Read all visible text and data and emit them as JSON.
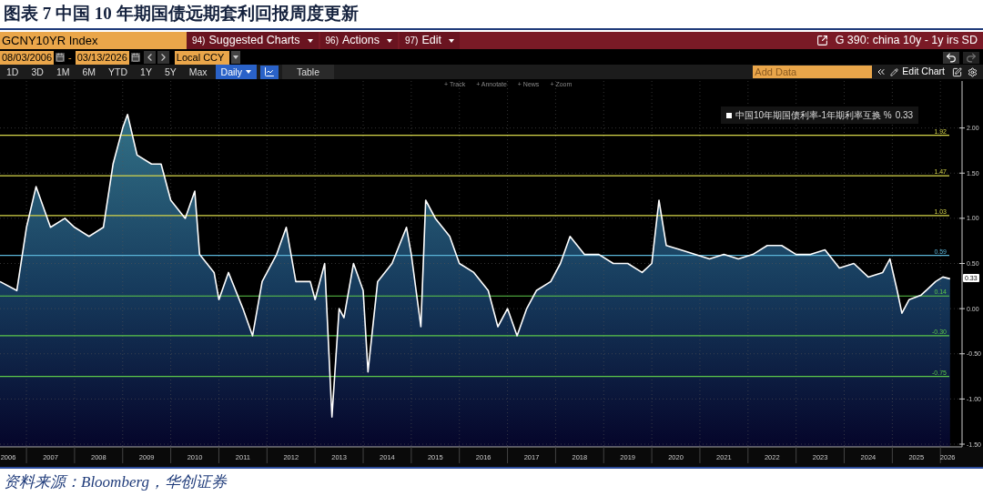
{
  "figure_title": "图表 7 中国 10 年期国债远期套利回报周度更新",
  "terminal": {
    "security_field": "GCNY10YR Index",
    "menu": [
      {
        "number": "94)",
        "label": "Suggested Charts"
      },
      {
        "number": "96)",
        "label": "Actions"
      },
      {
        "number": "97)",
        "label": "Edit"
      }
    ],
    "function_title": "G 390: china 10y - 1y irs SD",
    "date_start": "08/03/2006",
    "date_separator": "-",
    "date_end": "03/13/2026",
    "currency": "Local CCY",
    "ranges": [
      {
        "label": "1D",
        "selected": false
      },
      {
        "label": "3D",
        "selected": false
      },
      {
        "label": "1M",
        "selected": false
      },
      {
        "label": "6M",
        "selected": false
      },
      {
        "label": "YTD",
        "selected": false
      },
      {
        "label": "1Y",
        "selected": false
      },
      {
        "label": "5Y",
        "selected": false
      },
      {
        "label": "Max",
        "selected": false
      }
    ],
    "frequency": "Daily",
    "views": [
      {
        "kind": "icon",
        "selected": true
      },
      {
        "kind": "text",
        "label": "Table",
        "selected": false
      }
    ],
    "add_data_placeholder": "Add Data",
    "edit_chart": "Edit Chart",
    "chart_tools": [
      "+ Track",
      "+ Annotate",
      "+ News",
      "+ Zoom"
    ],
    "legend_value": "0.33",
    "last_value_tag": "0.33",
    "chart_data": {
      "type": "area",
      "x": [
        2006.45,
        2006.8,
        2007.0,
        2007.2,
        2007.5,
        2007.8,
        2008.0,
        2008.3,
        2008.6,
        2008.8,
        2009.0,
        2009.1,
        2009.3,
        2009.6,
        2009.8,
        2010.0,
        2010.3,
        2010.5,
        2010.6,
        2010.9,
        2011.0,
        2011.2,
        2011.5,
        2011.7,
        2011.9,
        2012.2,
        2012.4,
        2012.6,
        2012.9,
        2013.0,
        2013.2,
        2013.35,
        2013.5,
        2013.6,
        2013.8,
        2014.0,
        2014.1,
        2014.3,
        2014.6,
        2014.9,
        2015.0,
        2015.2,
        2015.3,
        2015.5,
        2015.8,
        2016.0,
        2016.3,
        2016.6,
        2016.8,
        2017.0,
        2017.2,
        2017.4,
        2017.6,
        2017.9,
        2018.1,
        2018.3,
        2018.6,
        2018.9,
        2019.2,
        2019.5,
        2019.8,
        2020.0,
        2020.15,
        2020.3,
        2020.6,
        2020.9,
        2021.2,
        2021.5,
        2021.8,
        2022.1,
        2022.4,
        2022.7,
        2023.0,
        2023.3,
        2023.6,
        2023.9,
        2024.2,
        2024.5,
        2024.8,
        2024.95,
        2025.1,
        2025.2,
        2025.35,
        2025.6,
        2025.9,
        2026.05,
        2026.2
      ],
      "series": [
        {
          "name": "中国10年期国债利率-1年期利率互换 %",
          "color": "#ffffff",
          "values": [
            0.3,
            0.2,
            0.9,
            1.35,
            0.9,
            1.0,
            0.9,
            0.8,
            0.9,
            1.6,
            2.0,
            2.15,
            1.7,
            1.6,
            1.6,
            1.2,
            1.0,
            1.3,
            0.6,
            0.4,
            0.1,
            0.4,
            0.0,
            -0.3,
            0.3,
            0.6,
            0.9,
            0.3,
            0.3,
            0.1,
            0.5,
            -1.2,
            0.0,
            -0.1,
            0.5,
            0.2,
            -0.7,
            0.3,
            0.5,
            0.9,
            0.6,
            -0.2,
            1.2,
            1.0,
            0.8,
            0.5,
            0.4,
            0.2,
            -0.2,
            0.0,
            -0.3,
            0.0,
            0.2,
            0.3,
            0.5,
            0.8,
            0.6,
            0.6,
            0.5,
            0.5,
            0.4,
            0.5,
            1.2,
            0.7,
            0.65,
            0.6,
            0.55,
            0.6,
            0.55,
            0.6,
            0.7,
            0.7,
            0.6,
            0.6,
            0.65,
            0.45,
            0.5,
            0.35,
            0.4,
            0.55,
            0.2,
            -0.05,
            0.1,
            0.15,
            0.3,
            0.35,
            0.33
          ]
        }
      ],
      "ylim": [
        -1.53,
        2.52
      ],
      "yticks": [
        {
          "value": 2,
          "label": "2.00"
        },
        {
          "value": 1.5,
          "label": "1.50"
        },
        {
          "value": 1,
          "label": "1.00"
        },
        {
          "value": 0.5,
          "label": "0.50"
        },
        {
          "value": 0,
          "label": "0.00"
        },
        {
          "value": -0.5,
          "label": "-0.50"
        },
        {
          "value": -1,
          "label": "-1.00"
        },
        {
          "value": -1.5,
          "label": "-1.50"
        }
      ],
      "xlim": [
        2006.45,
        2026.45
      ],
      "grid": true,
      "xticks": [
        {
          "value": 2006.5,
          "label": "2006"
        },
        {
          "value": 2007.5,
          "label": "2007"
        },
        {
          "value": 2008.5,
          "label": "2008"
        },
        {
          "value": 2009.5,
          "label": "2009"
        },
        {
          "value": 2010.5,
          "label": "2010"
        },
        {
          "value": 2011.5,
          "label": "2011"
        },
        {
          "value": 2012.5,
          "label": "2012"
        },
        {
          "value": 2013.5,
          "label": "2013"
        },
        {
          "value": 2014.5,
          "label": "2014"
        },
        {
          "value": 2015.5,
          "label": "2015"
        },
        {
          "value": 2016.5,
          "label": "2016"
        },
        {
          "value": 2017.5,
          "label": "2017"
        },
        {
          "value": 2018.5,
          "label": "2018"
        },
        {
          "value": 2019.5,
          "label": "2019"
        },
        {
          "value": 2020.5,
          "label": "2020"
        },
        {
          "value": 2021.5,
          "label": "2021"
        },
        {
          "value": 2022.5,
          "label": "2022"
        },
        {
          "value": 2023.5,
          "label": "2023"
        },
        {
          "value": 2024.5,
          "label": "2024"
        },
        {
          "value": 2025.5,
          "label": "2025"
        },
        {
          "value": 2026.15,
          "label": "2026"
        }
      ],
      "ref_lines": [
        {
          "axis": "y",
          "value": 1.92,
          "label": "1.92",
          "color": "#d6d64a"
        },
        {
          "axis": "y",
          "value": 1.47,
          "label": "1.47",
          "color": "#d6d64a"
        },
        {
          "axis": "y",
          "value": 1.03,
          "label": "1.03",
          "color": "#d6d64a"
        },
        {
          "axis": "y",
          "value": 0.59,
          "label": "0.59",
          "color": "#5ab4d8"
        },
        {
          "axis": "y",
          "value": 0.14,
          "label": "0.14",
          "color": "#5cc84a"
        },
        {
          "axis": "y",
          "value": -0.3,
          "label": "-0.30",
          "color": "#5cc84a"
        },
        {
          "axis": "y",
          "value": -0.75,
          "label": "-0.75",
          "color": "#5cc84a"
        }
      ]
    }
  },
  "source": "资料来源：Bloomberg，华创证券"
}
